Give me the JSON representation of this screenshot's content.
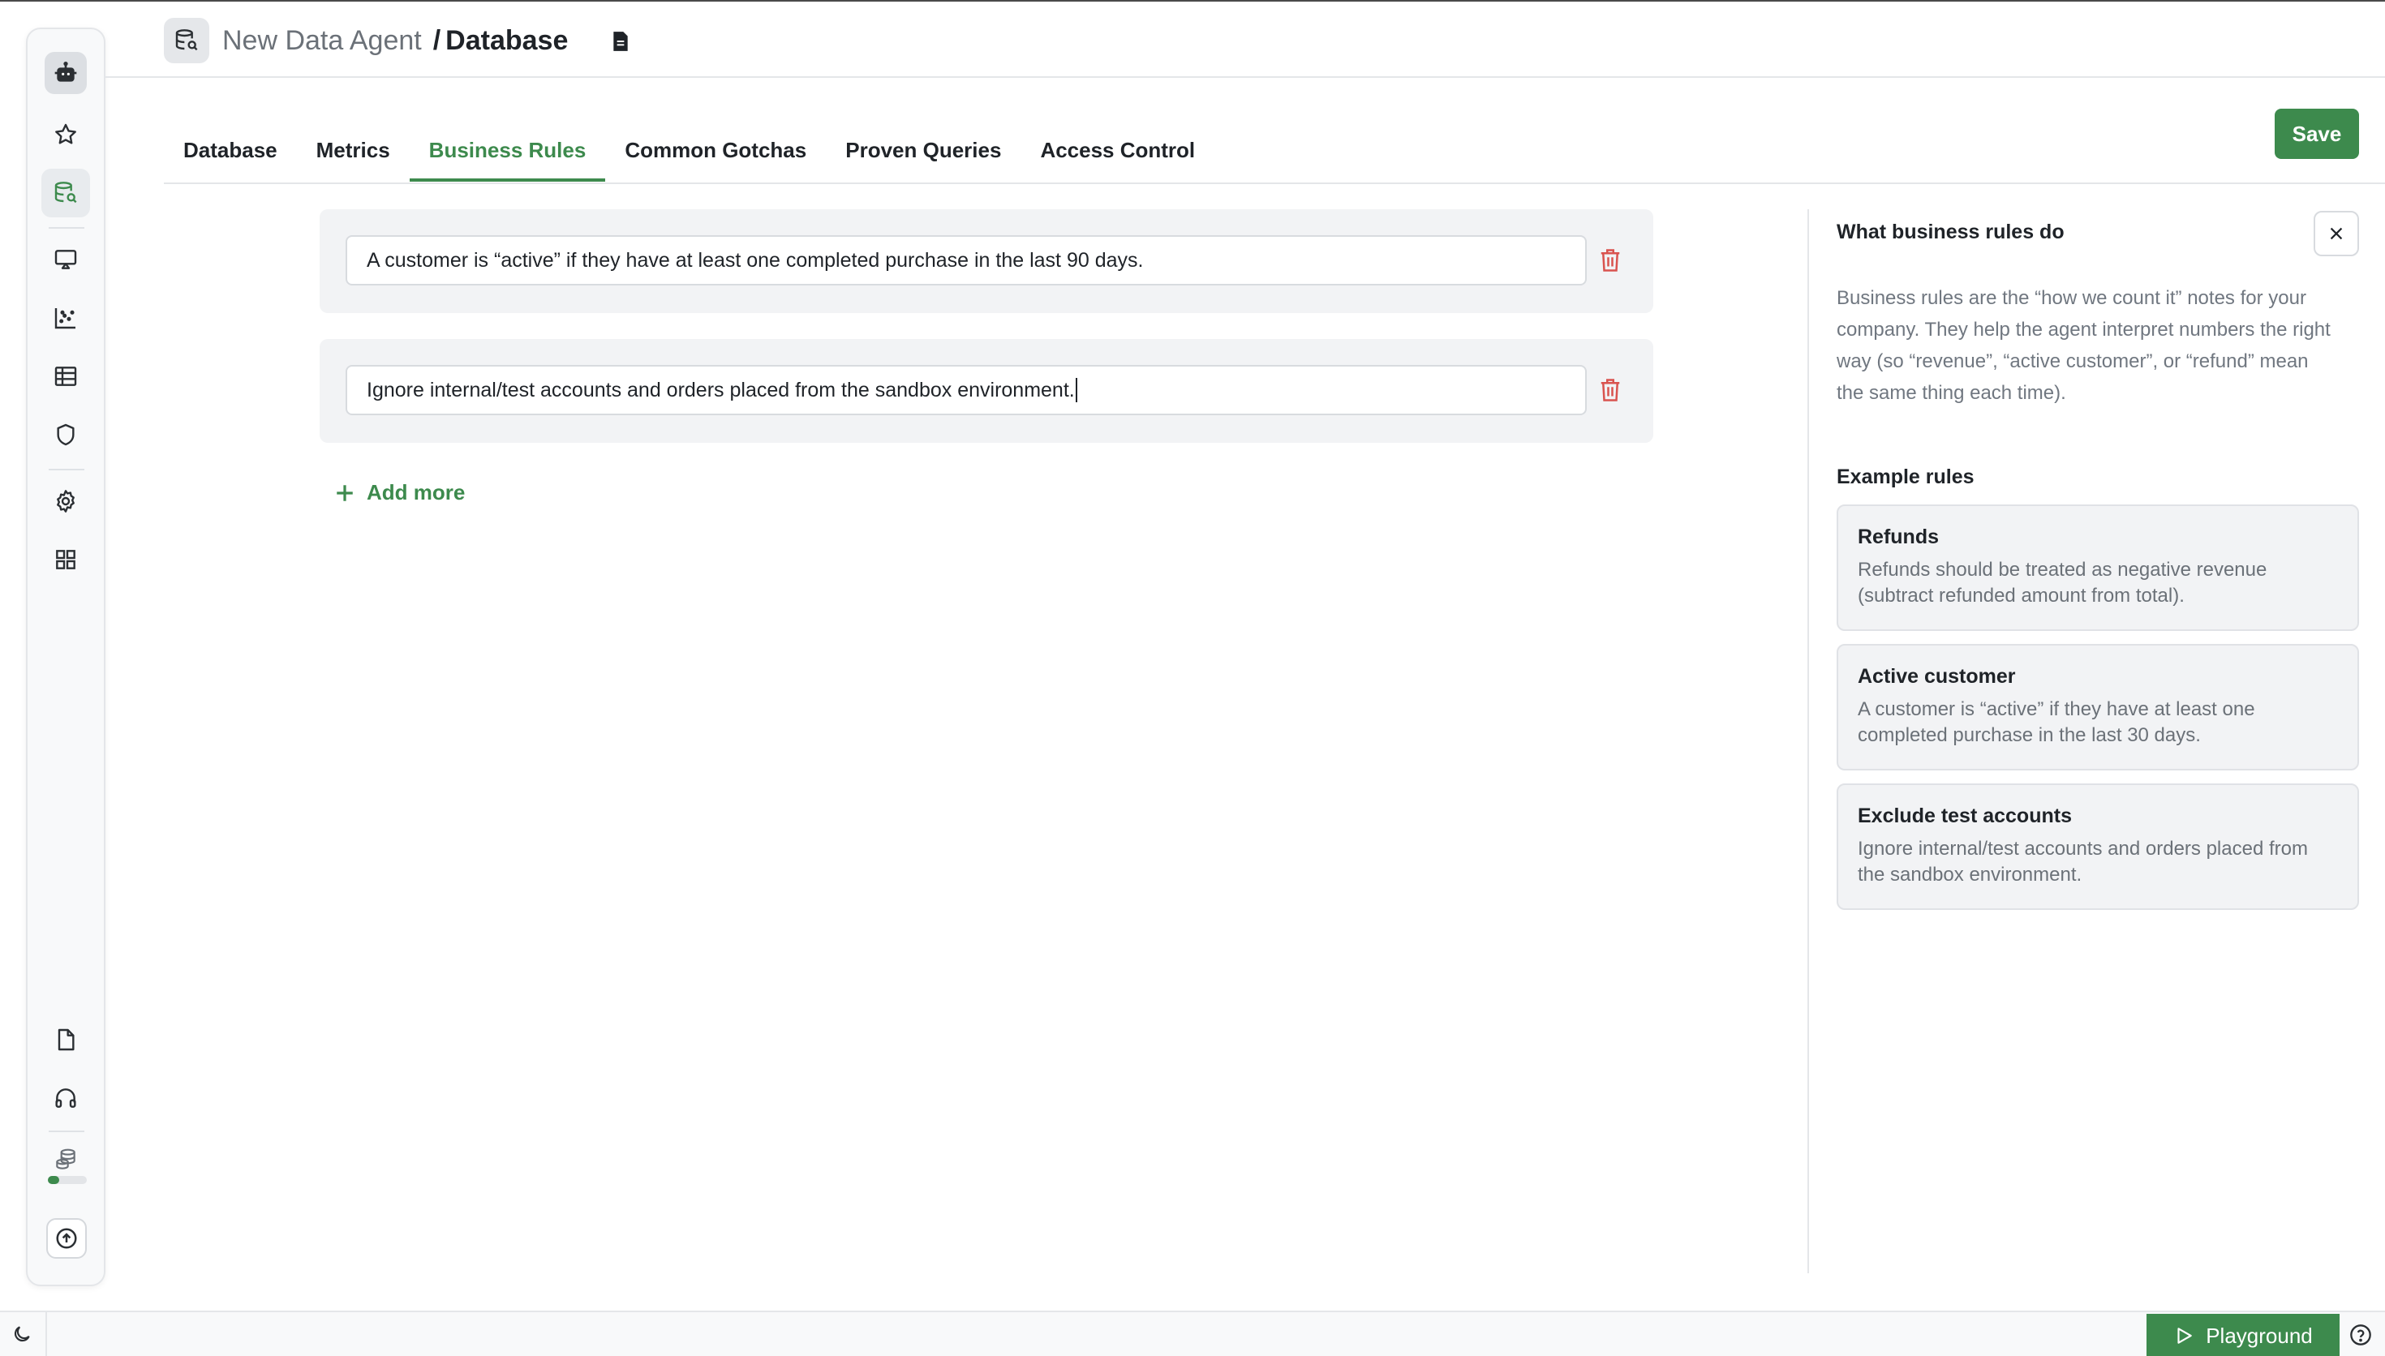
{
  "header": {
    "agent_name": "New Data Agent",
    "separator": "/",
    "page_title": "Database"
  },
  "tabs": [
    {
      "label": "Database",
      "active": false
    },
    {
      "label": "Metrics",
      "active": false
    },
    {
      "label": "Business Rules",
      "active": true
    },
    {
      "label": "Common Gotchas",
      "active": false
    },
    {
      "label": "Proven Queries",
      "active": false
    },
    {
      "label": "Access Control",
      "active": false
    }
  ],
  "actions": {
    "save_label": "Save",
    "add_more_label": "Add more"
  },
  "rules": [
    {
      "value": "A customer is “active” if they have at least one completed purchase in the last 90 days."
    },
    {
      "value": "Ignore internal/test accounts and orders placed from the sandbox environment."
    }
  ],
  "panel": {
    "title": "What business rules do",
    "description": "Business rules are the “how we count it” notes for your company. They help the agent interpret numbers the right way (so “revenue”, “active customer”, or “refund” mean the same thing each time).",
    "examples_heading": "Example rules",
    "examples": [
      {
        "title": "Refunds",
        "text": "Refunds should be treated as negative revenue (subtract refunded amount from total)."
      },
      {
        "title": "Active customer",
        "text": "A customer is “active” if they have at least one completed purchase in the last 30 days."
      },
      {
        "title": "Exclude test accounts",
        "text": "Ignore internal/test accounts and orders placed from the sandbox environment."
      }
    ]
  },
  "footer": {
    "playground_label": "Playground"
  },
  "credits": {
    "used_fraction": 0.3
  },
  "colors": {
    "accent": "#3d8a4d",
    "danger": "#d9534f",
    "icon": "#2b2f33"
  },
  "sidebar_icons": [
    "robot-icon",
    "star-icon",
    "database-search-icon",
    "presentation-icon",
    "scatter-chart-icon",
    "table-icon",
    "shield-icon",
    "gear-icon",
    "grid-icon",
    "document-icon",
    "headphones-icon",
    "coins-icon",
    "upload-icon"
  ]
}
